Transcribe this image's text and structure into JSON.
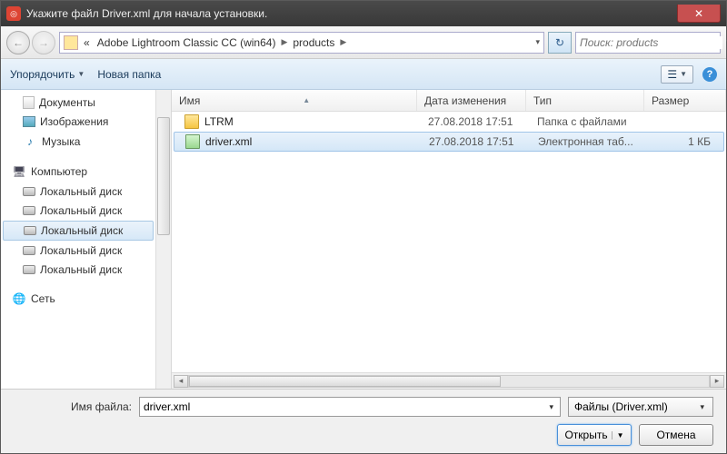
{
  "title": "Укажите файл Driver.xml для начала установки.",
  "breadcrumbs": {
    "prefix": "«",
    "p1": "Adobe Lightroom Classic CC (win64)",
    "p2": "products"
  },
  "search": {
    "placeholder": "Поиск: products"
  },
  "toolbar": {
    "organize": "Упорядочить",
    "newfolder": "Новая папка"
  },
  "columns": {
    "name": "Имя",
    "date": "Дата изменения",
    "type": "Тип",
    "size": "Размер"
  },
  "sidebar": {
    "docs": "Документы",
    "images": "Изображения",
    "music": "Музыка",
    "computer": "Компьютер",
    "d1": "Локальный диск",
    "d2": "Локальный диск",
    "d3": "Локальный диск",
    "d4": "Локальный диск",
    "d5": "Локальный диск",
    "network": "Сеть"
  },
  "files": {
    "r0": {
      "name": "LTRM",
      "date": "27.08.2018 17:51",
      "type": "Папка с файлами",
      "size": ""
    },
    "r1": {
      "name": "driver.xml",
      "date": "27.08.2018 17:51",
      "type": "Электронная таб...",
      "size": "1 КБ"
    }
  },
  "footer": {
    "filename_label": "Имя файла:",
    "filename_value": "driver.xml",
    "filter": "Файлы (Driver.xml)",
    "open": "Открыть",
    "cancel": "Отмена"
  }
}
